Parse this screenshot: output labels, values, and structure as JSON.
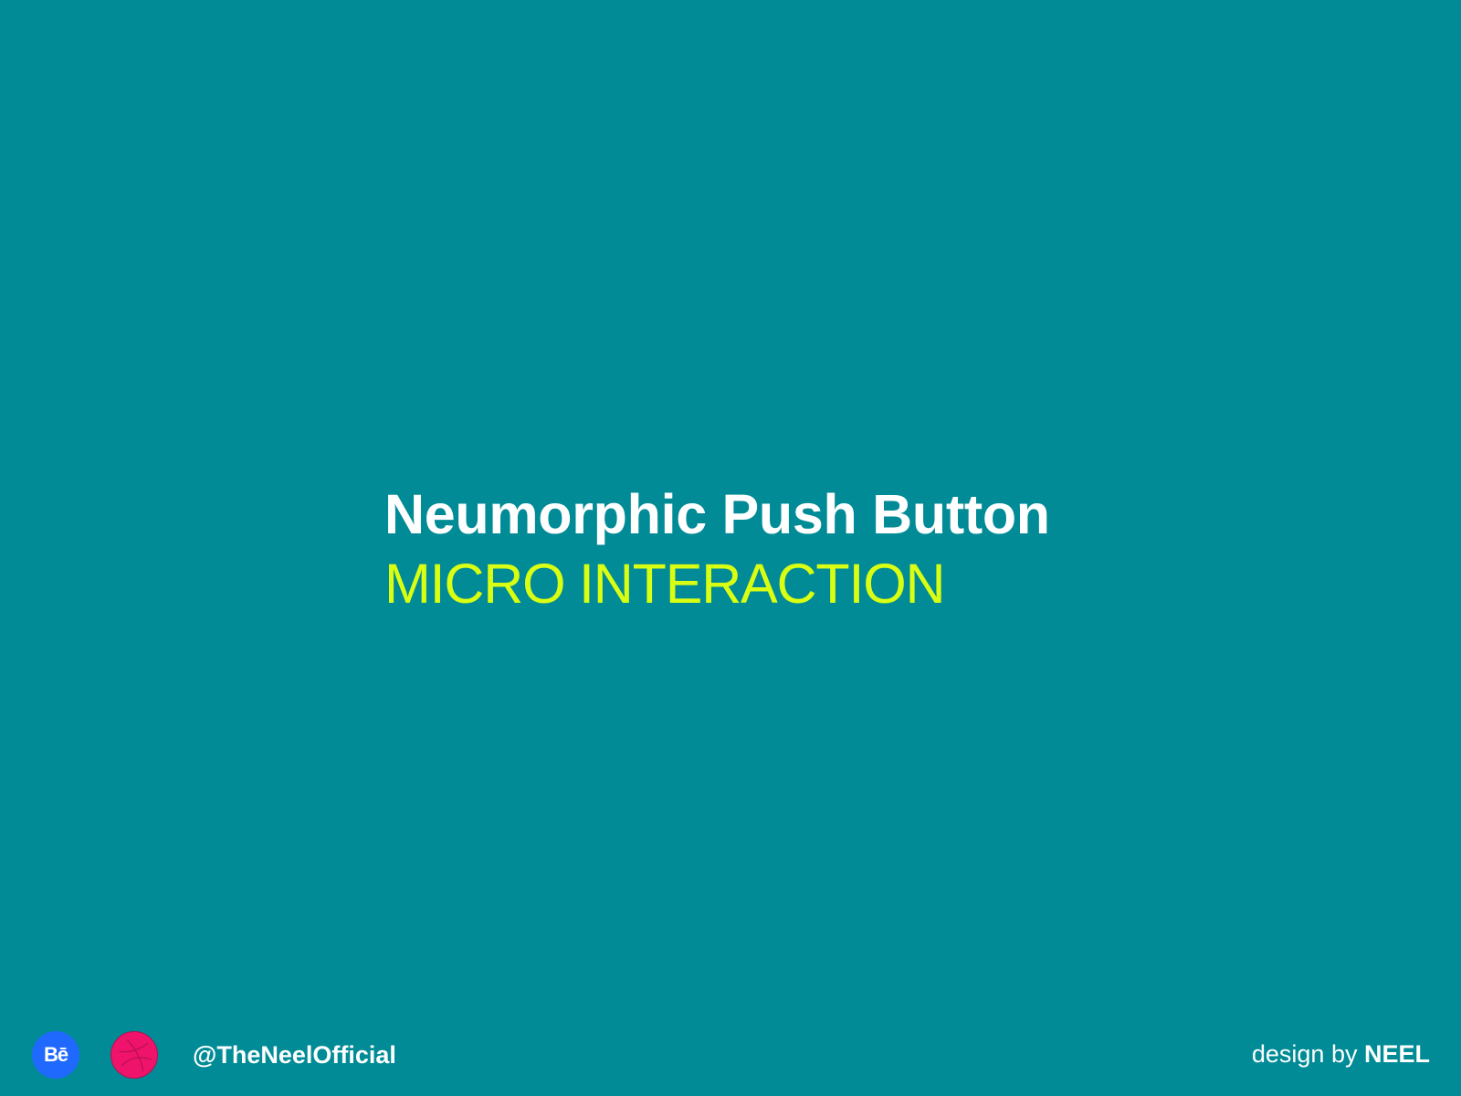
{
  "hero": {
    "title": "Neumorphic Push Button",
    "subtitle": "MICRO INTERACTION"
  },
  "footer": {
    "behance_icon_label": "Bē",
    "icons": [
      "behance-icon",
      "dribbble-icon"
    ],
    "handle": "@TheNeelOfficial",
    "credit_prefix": "design by",
    "credit_name": "NEEL"
  },
  "colors": {
    "background": "#008b96",
    "title": "#ffffff",
    "subtitle_accent": "#d9ff12",
    "behance": "#1f69ff",
    "dribbble": "#f0136b"
  }
}
